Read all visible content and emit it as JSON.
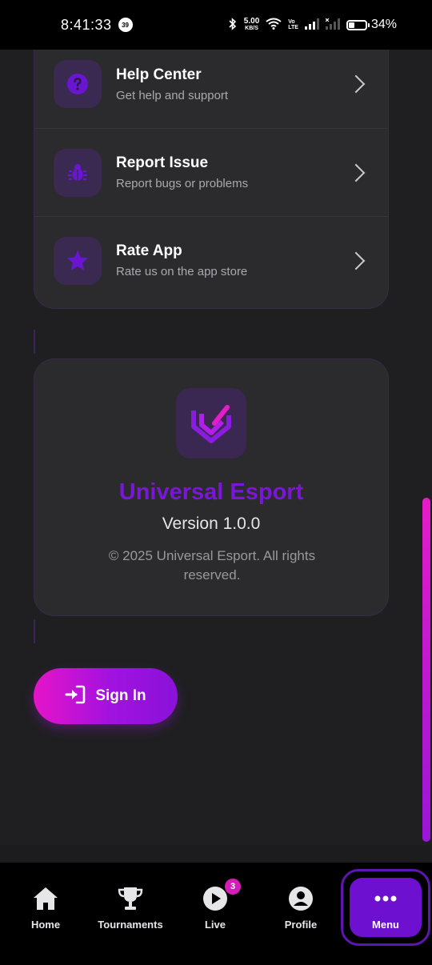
{
  "status_bar": {
    "time": "8:41:33",
    "notification_count": "39",
    "net_speed": "5.00",
    "net_speed_unit": "KB/S",
    "volte_top": "Vo",
    "volte_bottom": "LTE",
    "battery_percent": "34%",
    "battery_level": 0.34
  },
  "support_items": [
    {
      "title": "Help Center",
      "subtitle": "Get help and support",
      "icon": "help-circle-icon"
    },
    {
      "title": "Report Issue",
      "subtitle": "Report bugs or problems",
      "icon": "bug-icon"
    },
    {
      "title": "Rate App",
      "subtitle": "Rate us on the app store",
      "icon": "star-icon"
    }
  ],
  "about": {
    "app_name": "Universal Esport",
    "version": "Version 1.0.0",
    "copyright": "© 2025 Universal Esport. All rights reserved."
  },
  "sign_in": {
    "label": "Sign In"
  },
  "bottom_nav": {
    "items": [
      {
        "label": "Home",
        "icon": "home-icon"
      },
      {
        "label": "Tournaments",
        "icon": "trophy-icon"
      },
      {
        "label": "Live",
        "icon": "live-play-icon",
        "badge": "3"
      },
      {
        "label": "Profile",
        "icon": "profile-icon"
      },
      {
        "label": "Menu",
        "icon": "more-dots-icon",
        "active": true
      }
    ]
  },
  "colors": {
    "accent": "#7a16d6",
    "accent_pink": "#e614c8",
    "card_bg": "#2b2b2e",
    "page_bg": "#1f1f21"
  }
}
